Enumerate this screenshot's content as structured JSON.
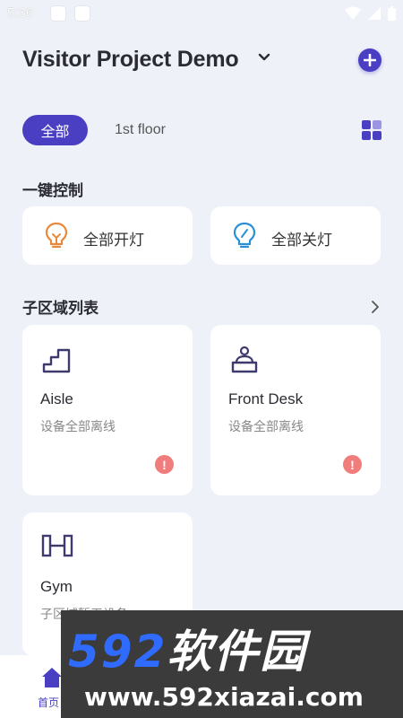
{
  "status_bar": {
    "time": "5:36"
  },
  "header": {
    "project_title": "Visitor Project Demo"
  },
  "floor_tabs": {
    "active": "全部",
    "other": "1st floor"
  },
  "quick_control": {
    "title": "一键控制",
    "all_on": "全部开灯",
    "all_off": "全部关灯"
  },
  "sub_areas": {
    "title": "子区域列表",
    "items": [
      {
        "name": "Aisle",
        "status": "设备全部离线",
        "icon": "stairs-icon"
      },
      {
        "name": "Front Desk",
        "status": "设备全部离线",
        "icon": "front-desk-icon"
      },
      {
        "name": "Gym",
        "status": "子区域暂无设备",
        "icon": "dumbbell-icon"
      }
    ]
  },
  "tabbar": {
    "home": "首页"
  },
  "watermark": {
    "brand_num": "592",
    "brand_cn": "软件园",
    "url": "www.592xiazai.com"
  },
  "colors": {
    "accent": "#4a3fc2",
    "warning": "#f07c7c",
    "bulb_on": "#e8883a",
    "bulb_off": "#2a8fd6",
    "icon_dark": "#3e3a6e"
  }
}
